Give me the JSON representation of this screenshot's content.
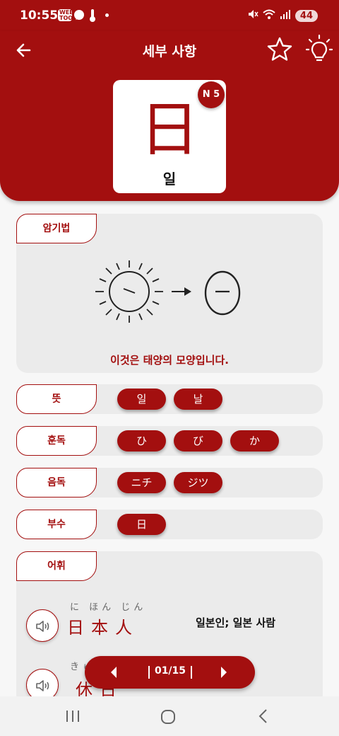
{
  "status_bar": {
    "time": "10:55",
    "badge1": "WEB TOON",
    "battery": "44"
  },
  "header": {
    "title": "세부 사항",
    "kanji": "日",
    "reading": "일",
    "level": "N 5"
  },
  "mnemonic": {
    "label": "암기법",
    "text": "이것은 태양의 모양입니다."
  },
  "meaning": {
    "label": "뜻",
    "chips": [
      "일",
      "날"
    ]
  },
  "kun": {
    "label": "훈독",
    "chips": [
      "ひ",
      "び",
      "か"
    ]
  },
  "on": {
    "label": "음독",
    "chips": [
      "ニチ",
      "ジツ"
    ]
  },
  "radical": {
    "label": "부수",
    "chips": [
      "日"
    ]
  },
  "vocab": {
    "label": "어휘",
    "items": [
      {
        "furigana": "に ほん じん",
        "word": "日本人",
        "meaning": "일본인; 일본 사람"
      },
      {
        "furigana": "きゅ",
        "word": "休日",
        "meaning": ""
      }
    ]
  },
  "pager": {
    "text": "01/15"
  },
  "colors": {
    "accent": "#a30f0f",
    "panel": "#ebebeb"
  }
}
